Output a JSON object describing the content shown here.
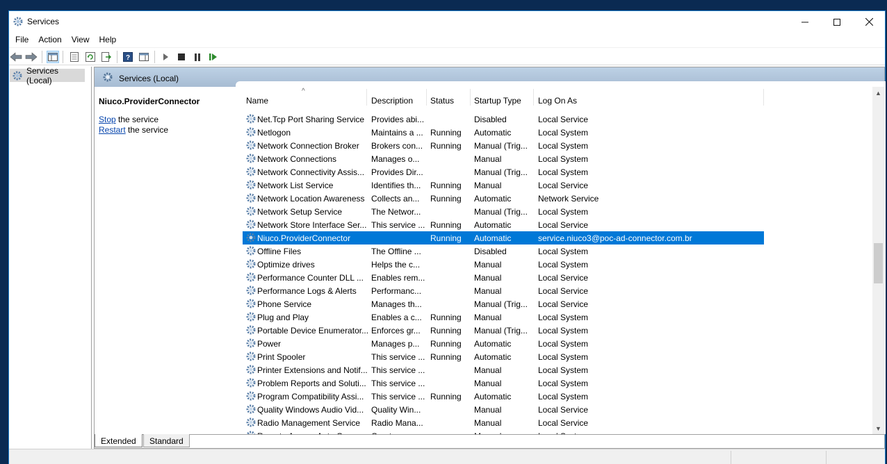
{
  "window": {
    "title": "Services"
  },
  "menu": [
    "File",
    "Action",
    "View",
    "Help"
  ],
  "tree": {
    "item": "Services (Local)"
  },
  "pane": {
    "header": "Services (Local)"
  },
  "selected": {
    "name": "Niuco.ProviderConnector",
    "stop_link": "Stop",
    "stop_rest": " the service",
    "restart_link": "Restart",
    "restart_rest": " the service"
  },
  "columns": {
    "name": "Name",
    "description": "Description",
    "status": "Status",
    "startup": "Startup Type",
    "logon": "Log On As"
  },
  "services": [
    {
      "name": "Net.Tcp Port Sharing Service",
      "description": "Provides abi...",
      "status": "",
      "startup": "Disabled",
      "logon": "Local Service"
    },
    {
      "name": "Netlogon",
      "description": "Maintains a ...",
      "status": "Running",
      "startup": "Automatic",
      "logon": "Local System"
    },
    {
      "name": "Network Connection Broker",
      "description": "Brokers con...",
      "status": "Running",
      "startup": "Manual (Trig...",
      "logon": "Local System"
    },
    {
      "name": "Network Connections",
      "description": "Manages o...",
      "status": "",
      "startup": "Manual",
      "logon": "Local System"
    },
    {
      "name": "Network Connectivity Assis...",
      "description": "Provides Dir...",
      "status": "",
      "startup": "Manual (Trig...",
      "logon": "Local System"
    },
    {
      "name": "Network List Service",
      "description": "Identifies th...",
      "status": "Running",
      "startup": "Manual",
      "logon": "Local Service"
    },
    {
      "name": "Network Location Awareness",
      "description": "Collects an...",
      "status": "Running",
      "startup": "Automatic",
      "logon": "Network Service"
    },
    {
      "name": "Network Setup Service",
      "description": "The Networ...",
      "status": "",
      "startup": "Manual (Trig...",
      "logon": "Local System"
    },
    {
      "name": "Network Store Interface Ser...",
      "description": "This service ...",
      "status": "Running",
      "startup": "Automatic",
      "logon": "Local Service"
    },
    {
      "name": "Niuco.ProviderConnector",
      "description": "",
      "status": "Running",
      "startup": "Automatic",
      "logon": "service.niuco3@poc-ad-connector.com.br",
      "selected": true
    },
    {
      "name": "Offline Files",
      "description": "The Offline ...",
      "status": "",
      "startup": "Disabled",
      "logon": "Local System"
    },
    {
      "name": "Optimize drives",
      "description": "Helps the c...",
      "status": "",
      "startup": "Manual",
      "logon": "Local System"
    },
    {
      "name": "Performance Counter DLL ...",
      "description": "Enables rem...",
      "status": "",
      "startup": "Manual",
      "logon": "Local Service"
    },
    {
      "name": "Performance Logs & Alerts",
      "description": "Performanc...",
      "status": "",
      "startup": "Manual",
      "logon": "Local Service"
    },
    {
      "name": "Phone Service",
      "description": "Manages th...",
      "status": "",
      "startup": "Manual (Trig...",
      "logon": "Local Service"
    },
    {
      "name": "Plug and Play",
      "description": "Enables a c...",
      "status": "Running",
      "startup": "Manual",
      "logon": "Local System"
    },
    {
      "name": "Portable Device Enumerator...",
      "description": "Enforces gr...",
      "status": "Running",
      "startup": "Manual (Trig...",
      "logon": "Local System"
    },
    {
      "name": "Power",
      "description": "Manages p...",
      "status": "Running",
      "startup": "Automatic",
      "logon": "Local System"
    },
    {
      "name": "Print Spooler",
      "description": "This service ...",
      "status": "Running",
      "startup": "Automatic",
      "logon": "Local System"
    },
    {
      "name": "Printer Extensions and Notif...",
      "description": "This service ...",
      "status": "",
      "startup": "Manual",
      "logon": "Local System"
    },
    {
      "name": "Problem Reports and Soluti...",
      "description": "This service ...",
      "status": "",
      "startup": "Manual",
      "logon": "Local System"
    },
    {
      "name": "Program Compatibility Assi...",
      "description": "This service ...",
      "status": "Running",
      "startup": "Automatic",
      "logon": "Local System"
    },
    {
      "name": "Quality Windows Audio Vid...",
      "description": "Quality Win...",
      "status": "",
      "startup": "Manual",
      "logon": "Local Service"
    },
    {
      "name": "Radio Management Service",
      "description": "Radio Mana...",
      "status": "",
      "startup": "Manual",
      "logon": "Local Service"
    },
    {
      "name": "Remote Access Auto Conne...",
      "description": "Creates a co...",
      "status": "",
      "startup": "Manual",
      "logon": "Local System"
    }
  ],
  "tabs": [
    "Extended",
    "Standard"
  ]
}
